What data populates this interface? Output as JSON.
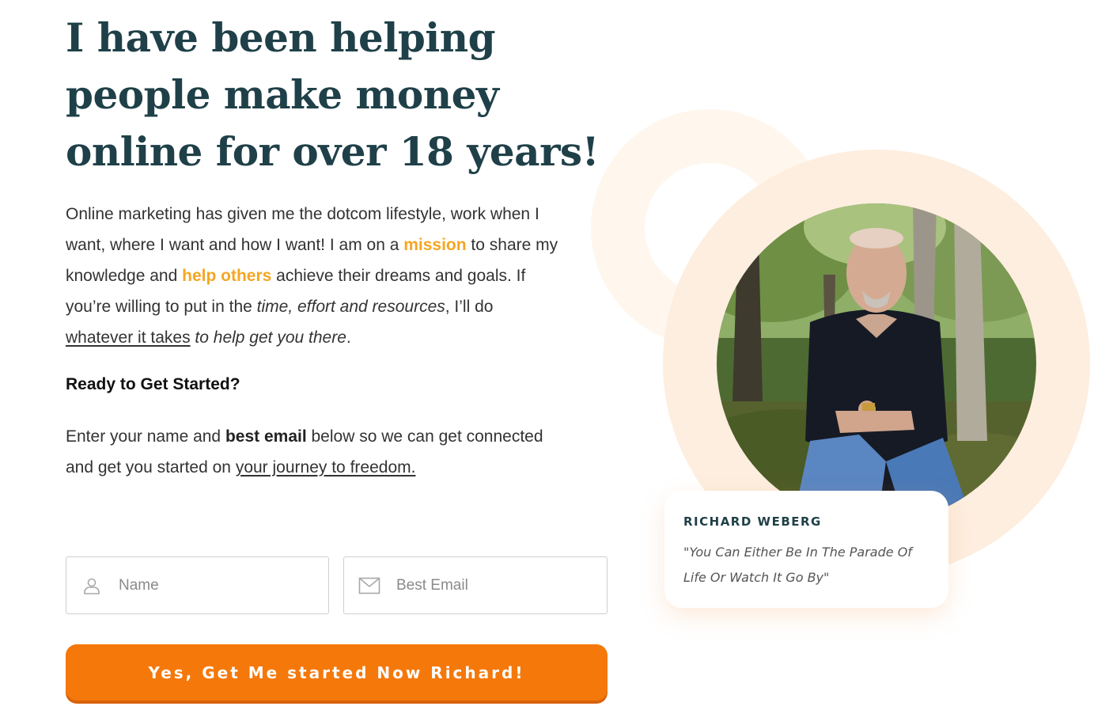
{
  "hero": {
    "headline": "I have been helping people make money online for over 18 years!"
  },
  "intro": {
    "p1": "Online marketing has given me the dotcom lifestyle, work when I want, where I want and how I want! I am on a ",
    "mission": "mission",
    "p2": " to share my knowledge and ",
    "help_others": "help others",
    "p3": " achieve their dreams and goals. If you’re willing to put in the ",
    "em1": "time, effort and resources",
    "p4": ", I’ll do ",
    "link_whatever": "whatever it takes",
    "em2": " to help get you there",
    "p5": "."
  },
  "ready": "Ready to Get Started?",
  "enter": {
    "p1": "Enter your name and ",
    "bold": "best email",
    "p2": " below so we can get connected and get you started on ",
    "link": "your journey to freedom."
  },
  "form": {
    "name_placeholder": "Name",
    "email_placeholder": "Best Email",
    "name_value": "",
    "email_value": "",
    "submit_label": "Yes, Get Me started Now Richard!"
  },
  "profile": {
    "name": "RICHARD WEBERG",
    "quote": "\"You Can Either Be In The Parade Of Life Or Watch It Go By\""
  },
  "icons": {
    "name_field": "user-icon",
    "email_field": "mail-icon"
  },
  "colors": {
    "headline": "#1f4048",
    "accent": "#f5a623",
    "button": "#f5780a",
    "ring_light": "#fff6ee",
    "ring": "#fdeedf"
  }
}
